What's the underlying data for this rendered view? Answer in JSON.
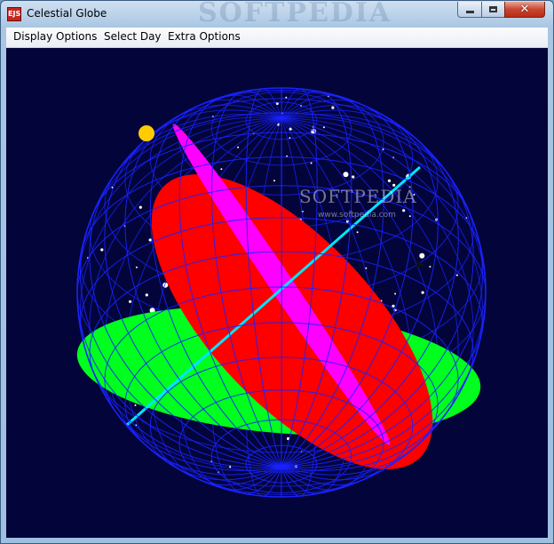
{
  "window": {
    "title": "Celestial Globe",
    "icon_label": "EJS",
    "controls": {
      "minimize": "minimize-icon",
      "maximize": "maximize-icon",
      "close": "close-icon"
    },
    "top_watermark": "SOFTPEDIA"
  },
  "menubar": {
    "items": [
      {
        "label": "Display Options"
      },
      {
        "label": "Select Day"
      },
      {
        "label": "Extra Options"
      }
    ]
  },
  "scene": {
    "watermark": "SOFTPEDIA",
    "watermark_url": "www.softpedia.com",
    "colors": {
      "background": "#03053a",
      "grid": "#1a22ff",
      "horizon": "#00ff1e",
      "ecliptic": "#ff0000",
      "equator": "#ff00ff",
      "axis": "#00e5ff",
      "sun": "#ffcc00",
      "stars": "#ffffff"
    }
  }
}
